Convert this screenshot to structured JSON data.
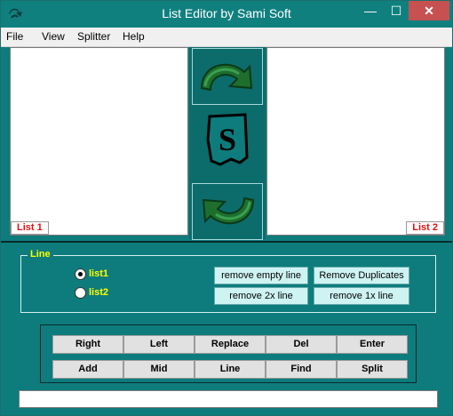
{
  "window": {
    "title": "List Editor by Sami Soft",
    "minimize_glyph": "—",
    "maximize_glyph": "☐",
    "close_glyph": "✕"
  },
  "menu": [
    "File",
    "View",
    "Splitter",
    "Help"
  ],
  "lists": {
    "left_tag": "List 1",
    "right_tag": "List 2"
  },
  "line_group": {
    "label": "Line",
    "radios": [
      {
        "label": "list1",
        "checked": true
      },
      {
        "label": "list2",
        "checked": false
      }
    ],
    "buttons": [
      "remove empty line",
      "Remove Duplicates",
      "remove 2x line",
      "remove 1x line"
    ]
  },
  "actions": {
    "row1": [
      "Right",
      "Left",
      "Replace",
      "Del",
      "Enter"
    ],
    "row2": [
      "Add",
      "Mid",
      "Line",
      "Find",
      "Split"
    ]
  },
  "icons": {
    "app": "app-icon",
    "transfer_right": "curved-arrow-right-icon",
    "transfer_left": "curved-arrow-left-icon",
    "logo": "s-logo-icon"
  },
  "colors": {
    "background": "#0e7c7c",
    "accent_text": "#ffff00",
    "tag_text": "#e01010",
    "close": "#c75050"
  }
}
